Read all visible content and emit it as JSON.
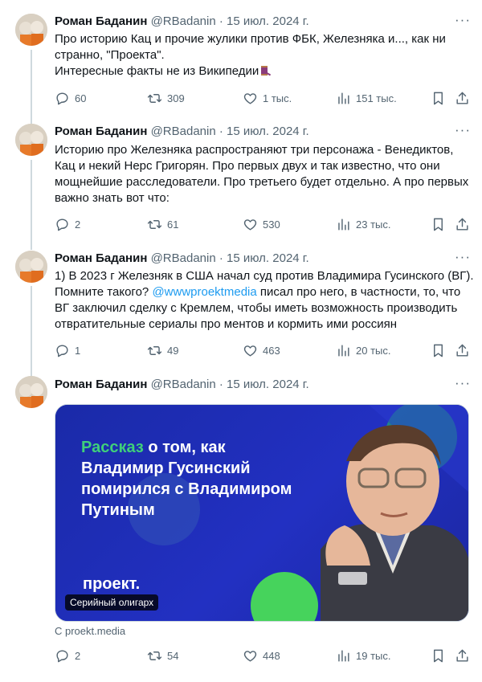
{
  "author": {
    "name": "Роман Баданин",
    "handle": "@RBadanin",
    "dot": "·",
    "date": "15 июл. 2024 г."
  },
  "tweets": [
    {
      "lines": [
        "Про историю Кац и прочие жулики против ФБК, Железняка и..., как ни",
        "странно, \"Проекта\".",
        "Интересные факты не из Википедии"
      ],
      "stats": {
        "replies": "60",
        "retweets": "309",
        "likes": "1 тыс.",
        "views": "151 тыс."
      }
    },
    {
      "lines": [
        "Историю про Железняка распространяют три  персонажа - Венедиктов,",
        "Кац и некий Нерс Григорян. Про первых двух и так известно, что они",
        "мощнейшие расследователи. Про третьего будет отдельно. А про первых",
        "важно знать вот что:"
      ],
      "stats": {
        "replies": "2",
        "retweets": "61",
        "likes": "530",
        "views": "23 тыс."
      }
    },
    {
      "lines": [
        "1) В 2023 г Железняк в США начал суд против Владимира Гусинского (ВГ).",
        "Помните такого?",
        "@wwwproektmedia",
        "писал про него, в частности, то, что",
        "ВГ заключил сделку с Кремлем, чтобы иметь возможность производить",
        "отвратительные сериалы про ментов и кормить ими россиян"
      ],
      "stats": {
        "replies": "1",
        "retweets": "49",
        "likes": "463",
        "views": "20 тыс."
      }
    },
    {
      "card": {
        "title_accent": "Рассказ",
        "title_l1": "о том, как",
        "title_l2": "Владимир Гусинский",
        "title_l3": "помирился с Владимиром",
        "title_l4": "Путиным",
        "brand": "проект.",
        "badge": "Серийный олигарх",
        "source": "С proekt.media"
      },
      "stats": {
        "replies": "2",
        "retweets": "54",
        "likes": "448",
        "views": "19 тыс."
      }
    }
  ],
  "colors": {
    "text": "#0f1419",
    "muted": "#536471",
    "link": "#1d9bf0",
    "card_bg": "#1c2bb0",
    "card_accent": "#3fd07a"
  }
}
